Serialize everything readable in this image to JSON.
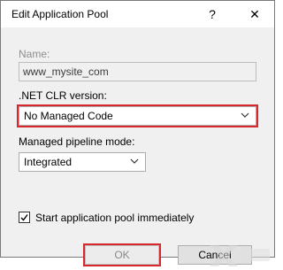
{
  "window": {
    "title": "Edit Application Pool",
    "help_glyph": "?",
    "close_glyph": "✕"
  },
  "form": {
    "name_label": "Name:",
    "name_value": "www_mysite_com",
    "clr_label": ".NET CLR version:",
    "clr_value": "No Managed Code",
    "pipeline_label": "Managed pipeline mode:",
    "pipeline_value": "Integrated",
    "start_label": "Start application pool immediately",
    "start_checked": true
  },
  "buttons": {
    "ok": "OK",
    "cancel": "Cancel"
  },
  "icons": {
    "close": "close-icon",
    "help": "help-icon",
    "chevron": "chevron-down-icon",
    "check": "checkmark-icon"
  },
  "colors": {
    "highlight": "#d9272e",
    "dialog_bg": "#f0f0f0"
  }
}
